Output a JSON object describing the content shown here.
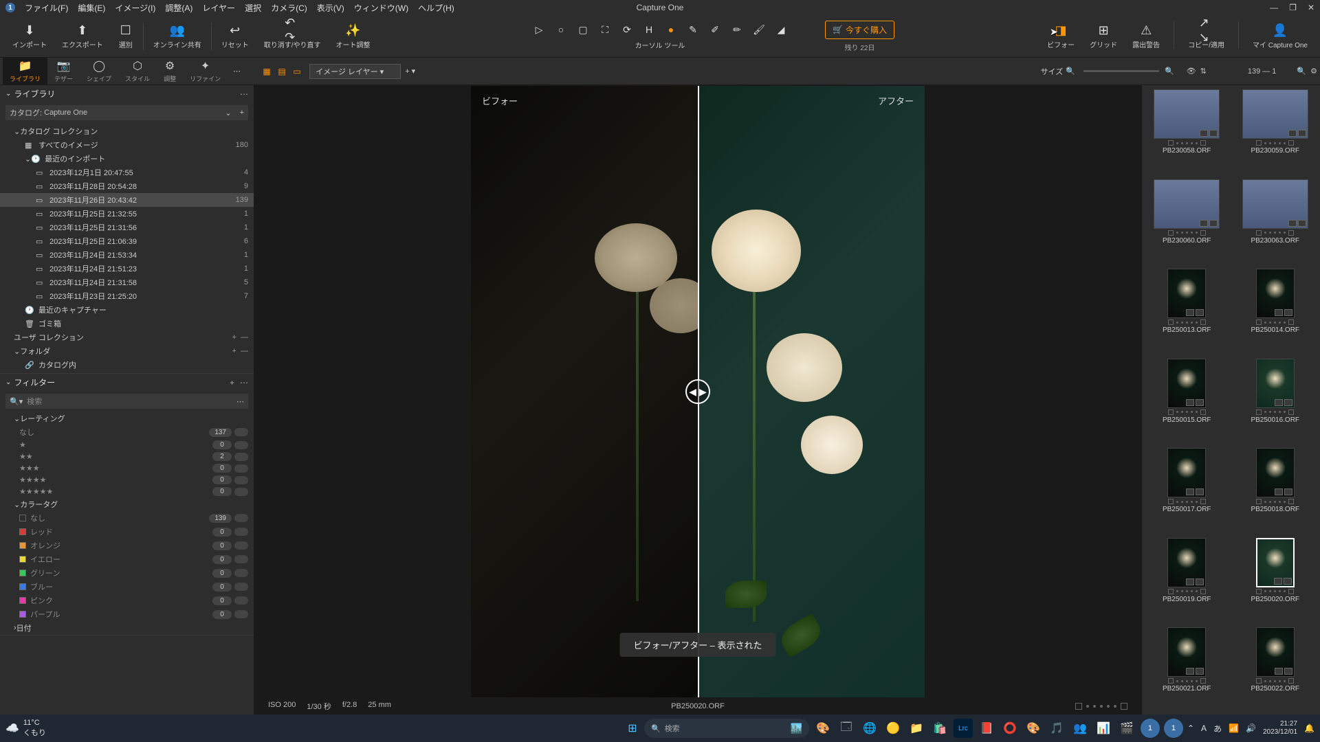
{
  "app": {
    "title": "Capture One"
  },
  "menubar": {
    "items": [
      "ファイル(F)",
      "編集(E)",
      "イメージ(I)",
      "調整(A)",
      "レイヤー",
      "選択",
      "カメラ(C)",
      "表示(V)",
      "ウィンドウ(W)",
      "ヘルプ(H)"
    ]
  },
  "toolbar": {
    "import": "インポート",
    "export": "エクスポート",
    "cull": "選別",
    "share": "オンライン共有",
    "reset": "リセット",
    "undo": "取り消す/やり直す",
    "auto": "オート調整",
    "cursor_label": "カーソル ツール",
    "buy": "今すぐ購入",
    "trial": "残り 22日",
    "before": "ビフォー",
    "grid": "グリッド",
    "exposure": "露出警告",
    "copy": "コピー/適用",
    "my": "マイ Capture One"
  },
  "tooltabs": {
    "items": [
      {
        "label": "ライブラリ"
      },
      {
        "label": "テザー"
      },
      {
        "label": "シェイプ"
      },
      {
        "label": "スタイル"
      },
      {
        "label": "調整"
      },
      {
        "label": "リファイン"
      }
    ],
    "layer": "イメージ レイヤー",
    "size": "サイズ"
  },
  "library": {
    "title": "ライブラリ",
    "catalog_prefix": "カタログ:",
    "catalog_name": "Capture One",
    "collections": "カタログ コレクション",
    "all_images": "すべてのイメージ",
    "all_count": "180",
    "recent_imports": "最近のインポート",
    "imports": [
      {
        "label": "2023年12月1日  20:47:55",
        "count": "4"
      },
      {
        "label": "2023年11月28日  20:54:28",
        "count": "9"
      },
      {
        "label": "2023年11月26日  20:43:42",
        "count": "139",
        "selected": true
      },
      {
        "label": "2023年11月25日  21:32:55",
        "count": "1"
      },
      {
        "label": "2023年11月25日  21:31:56",
        "count": "1"
      },
      {
        "label": "2023年11月25日  21:06:39",
        "count": "6"
      },
      {
        "label": "2023年11月24日  21:53:34",
        "count": "1"
      },
      {
        "label": "2023年11月24日  21:51:23",
        "count": "1"
      },
      {
        "label": "2023年11月24日  21:31:58",
        "count": "5"
      },
      {
        "label": "2023年11月23日  21:25:20",
        "count": "7"
      }
    ],
    "recent_captures": "最近のキャプチャー",
    "trash": "ゴミ箱",
    "user_collections": "ユーザ コレクション",
    "folders": "フォルダ",
    "in_catalog": "カタログ内"
  },
  "filters": {
    "title": "フィルター",
    "search_placeholder": "検索",
    "rating": "レーティング",
    "none": "なし",
    "rating_rows": [
      {
        "label": "なし",
        "count": "137"
      },
      {
        "label": "★",
        "count": "0"
      },
      {
        "label": "★★",
        "count": "2"
      },
      {
        "label": "★★★",
        "count": "0"
      },
      {
        "label": "★★★★",
        "count": "0"
      },
      {
        "label": "★★★★★",
        "count": "0"
      }
    ],
    "colortag": "カラータグ",
    "colors": [
      {
        "label": "なし",
        "count": "139",
        "hex": "transparent"
      },
      {
        "label": "レッド",
        "count": "0",
        "hex": "#d93a3a"
      },
      {
        "label": "オレンジ",
        "count": "0",
        "hex": "#e8953a"
      },
      {
        "label": "イエロー",
        "count": "0",
        "hex": "#e8d83a"
      },
      {
        "label": "グリーン",
        "count": "0",
        "hex": "#3ac85a"
      },
      {
        "label": "ブルー",
        "count": "0",
        "hex": "#3a7ae8"
      },
      {
        "label": "ピンク",
        "count": "0",
        "hex": "#e83aa8"
      },
      {
        "label": "パープル",
        "count": "0",
        "hex": "#a85ae8"
      }
    ],
    "date": "日付"
  },
  "viewer": {
    "before": "ビフォー",
    "after": "アフター",
    "toast": "ビフォー/アフター – 表示された",
    "iso": "ISO 200",
    "shutter": "1/30 秒",
    "aperture": "f/2.8",
    "focal": "25 mm",
    "filename": "PB250020.ORF"
  },
  "browser": {
    "counter": "139 — 1",
    "thumbs": [
      {
        "name": "PB230058.ORF",
        "kind": "cat"
      },
      {
        "name": "PB230059.ORF",
        "kind": "cat"
      },
      {
        "name": "PB230060.ORF",
        "kind": "cat"
      },
      {
        "name": "PB230063.ORF",
        "kind": "cat"
      },
      {
        "name": "PB250013.ORF",
        "kind": "flower",
        "portrait": true
      },
      {
        "name": "PB250014.ORF",
        "kind": "flower",
        "portrait": true
      },
      {
        "name": "PB250015.ORF",
        "kind": "flower",
        "portrait": true
      },
      {
        "name": "PB250016.ORF",
        "kind": "flower-after",
        "portrait": true
      },
      {
        "name": "PB250017.ORF",
        "kind": "flower",
        "portrait": true
      },
      {
        "name": "PB250018.ORF",
        "kind": "flower",
        "portrait": true
      },
      {
        "name": "PB250019.ORF",
        "kind": "flower",
        "portrait": true
      },
      {
        "name": "PB250020.ORF",
        "kind": "flower-after",
        "portrait": true,
        "selected": true
      },
      {
        "name": "PB250021.ORF",
        "kind": "flower",
        "portrait": true
      },
      {
        "name": "PB250022.ORF",
        "kind": "flower",
        "portrait": true
      }
    ]
  },
  "taskbar": {
    "temp": "11°C",
    "weather": "くもり",
    "search": "検索",
    "time": "21:27",
    "date": "2023/12/01"
  }
}
